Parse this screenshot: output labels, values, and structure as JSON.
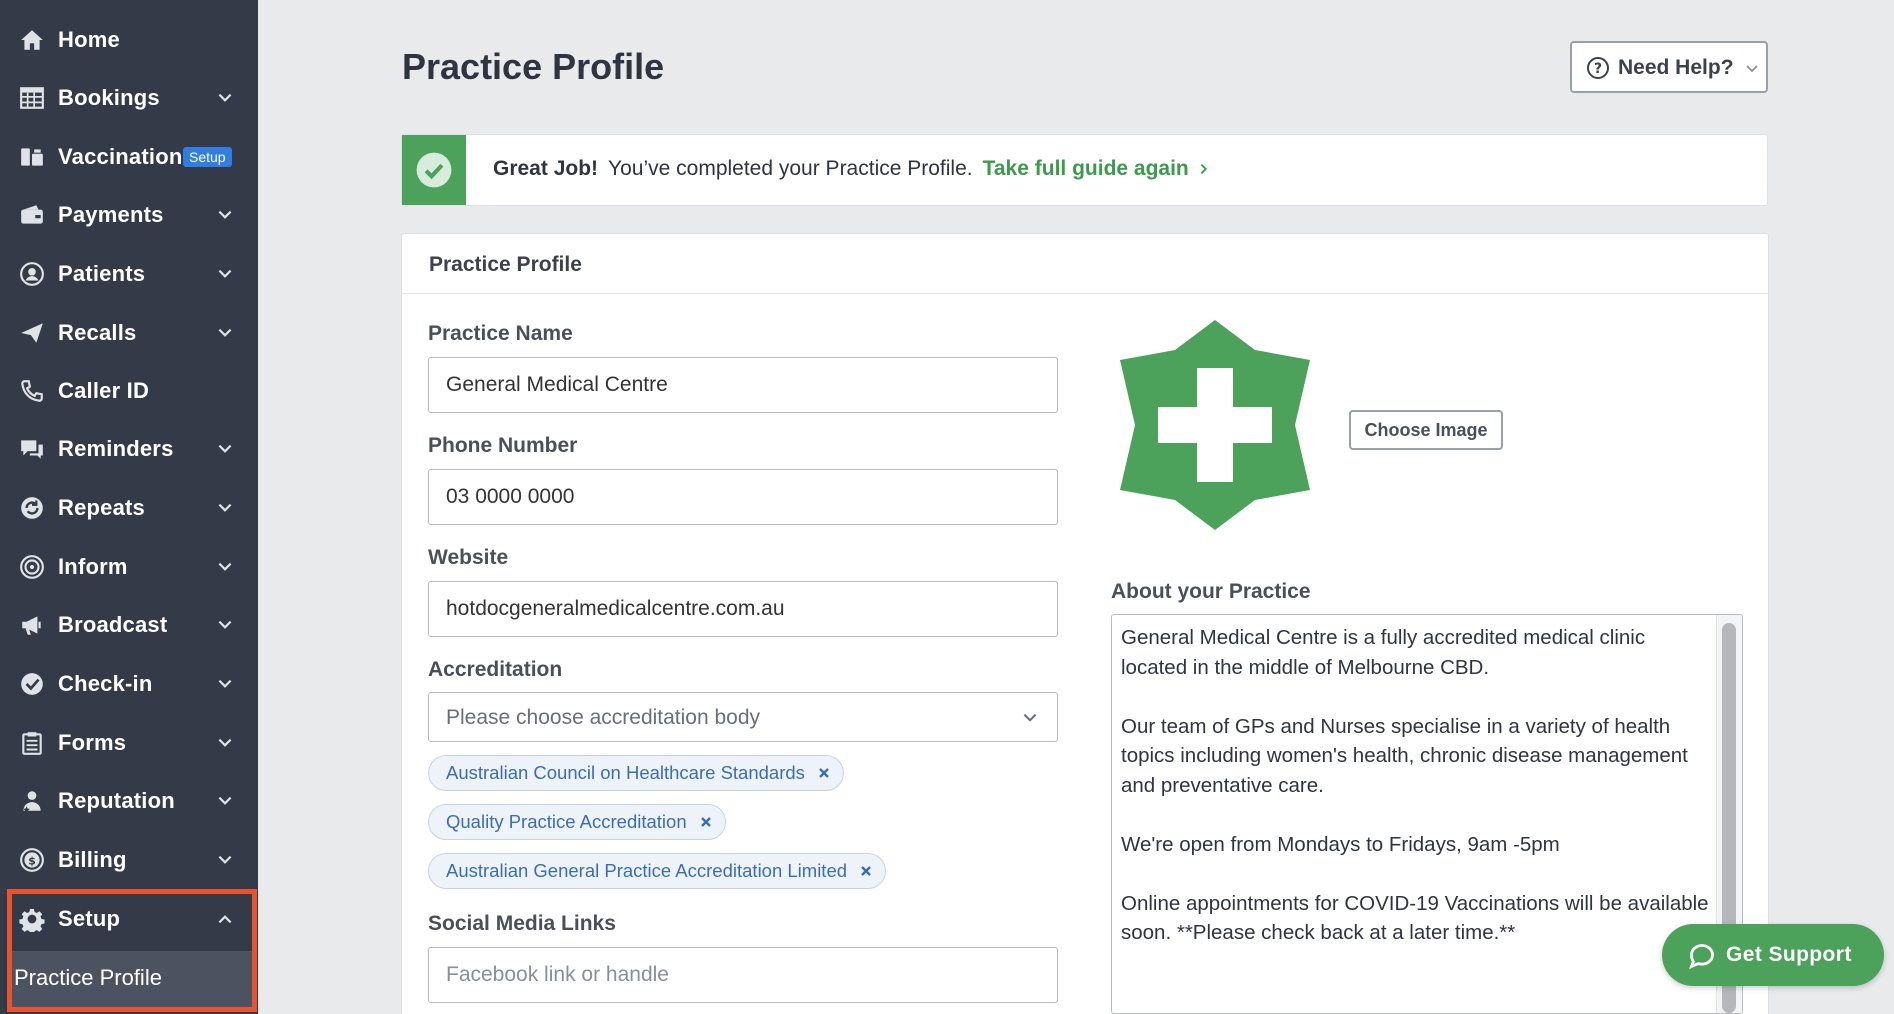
{
  "sidebar": {
    "items": [
      {
        "label": "Home",
        "icon": "home-icon"
      },
      {
        "label": "Bookings",
        "icon": "calendar-grid-icon"
      },
      {
        "label": "Vaccinations",
        "icon": "vaccine-icon",
        "badge": "Setup"
      },
      {
        "label": "Payments",
        "icon": "wallet-icon"
      },
      {
        "label": "Patients",
        "icon": "user-circle-icon"
      },
      {
        "label": "Recalls",
        "icon": "paper-plane-icon"
      },
      {
        "label": "Caller ID",
        "icon": "phone-icon"
      },
      {
        "label": "Reminders",
        "icon": "chat-bubbles-icon"
      },
      {
        "label": "Repeats",
        "icon": "refresh-icon"
      },
      {
        "label": "Inform",
        "icon": "target-icon"
      },
      {
        "label": "Broadcast",
        "icon": "megaphone-icon"
      },
      {
        "label": "Check-in",
        "icon": "check-badge-icon"
      },
      {
        "label": "Forms",
        "icon": "clipboard-icon"
      },
      {
        "label": "Reputation",
        "icon": "person-star-icon"
      },
      {
        "label": "Billing",
        "icon": "dollar-coin-icon"
      },
      {
        "label": "Setup",
        "icon": "gear-icon"
      }
    ],
    "setup_subitem": "Practice Profile"
  },
  "header": {
    "title": "Practice Profile",
    "help_label": "Need Help?"
  },
  "banner": {
    "strong": "Great Job!",
    "message": "You’ve completed your Practice Profile.",
    "link": "Take full guide again"
  },
  "card": {
    "title": "Practice Profile",
    "practice_name_label": "Practice Name",
    "practice_name_value": "General Medical Centre",
    "phone_label": "Phone Number",
    "phone_value": "03 0000 0000",
    "website_label": "Website",
    "website_value": "hotdocgeneralmedicalcentre.com.au",
    "accreditation_label": "Accreditation",
    "accreditation_placeholder": "Please choose accreditation body",
    "accreditation_tags": [
      "Australian Council on Healthcare Standards",
      "Quality Practice Accreditation",
      "Australian General Practice Accreditation Limited"
    ],
    "social_label": "Social Media Links",
    "social_placeholder": "Facebook link or handle",
    "choose_image_label": "Choose Image",
    "about_label": "About your Practice",
    "about_text": "General Medical Centre is a fully accredited medical clinic located in the middle of Melbourne CBD.\n\nOur team of GPs and Nurses specialise in a variety of health topics including women's health, chronic disease management and preventative care.\n\nWe're open from Mondays to Fridays, 9am -5pm\n\nOnline appointments for COVID-19 Vaccinations will be available soon. **Please check back at a later time.**"
  },
  "support": {
    "label": "Get Support"
  },
  "colors": {
    "sidebar_bg": "#343a47",
    "accent_green": "#4ca25a",
    "highlight_orange": "#e8542f",
    "tag_blue": "#3b6db0"
  }
}
